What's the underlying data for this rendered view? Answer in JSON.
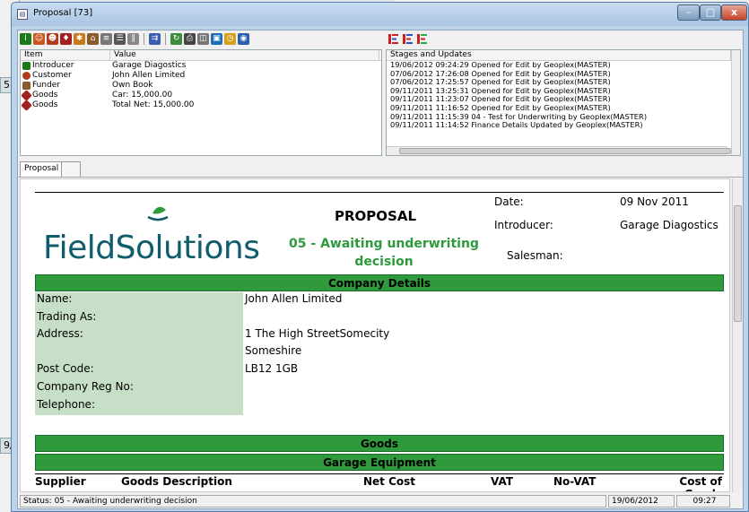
{
  "window": {
    "title": "Proposal [73]"
  },
  "background": {
    "left_chips": [
      "5]",
      "9/"
    ]
  },
  "panel": {
    "headers": [
      "Item",
      "Value"
    ],
    "rows": [
      {
        "item": "Introducer",
        "value": "Garage Diagostics",
        "icon": "introducer-icon",
        "color": "#1a7a1a"
      },
      {
        "item": "Customer",
        "value": "John Allen Limited",
        "icon": "customer-icon",
        "color": "#b33a1a"
      },
      {
        "item": "Funder",
        "value": "Own Book",
        "icon": "funder-icon",
        "color": "#8a5a2a"
      },
      {
        "item": "Goods",
        "value": "Car: 15,000.00",
        "icon": "goods-icon",
        "color": "#a52020"
      },
      {
        "item": "Goods",
        "value": "Total Net: 15,000.00",
        "icon": "goods-icon",
        "color": "#a52020"
      }
    ]
  },
  "stages": {
    "header": "Stages and Updates",
    "lines": [
      "19/06/2012 09:24:29 Opened for Edit by Geoplex(MASTER)",
      "07/06/2012 17:26:08 Opened for Edit by Geoplex(MASTER)",
      "07/06/2012 17:25:57 Opened for Edit by Geoplex(MASTER)",
      "09/11/2011 13:25:31 Opened for Edit by Geoplex(MASTER)",
      "09/11/2011 11:23:07 Opened for Edit by Geoplex(MASTER)",
      "09/11/2011 11:16:52 Opened for Edit by Geoplex(MASTER)",
      "09/11/2011 11:15:39 04 - Test for Underwriting by Geoplex(MASTER)",
      "09/11/2011 11:14:52 Finance Details Updated by Geoplex(MASTER)"
    ]
  },
  "tabs": {
    "proposal": "Proposal"
  },
  "document": {
    "logo": "FieldSolutions",
    "title": "PROPOSAL",
    "stage": "05 - Awaiting underwriting decision",
    "date_label": "Date:",
    "date_value": "09 Nov 2011",
    "introducer_label": "Introducer:",
    "introducer_value": "Garage Diagostics",
    "salesman_label": "Salesman:",
    "company_section": "Company Details",
    "details": [
      {
        "label": "Name:",
        "value": "John Allen Limited"
      },
      {
        "label": "Trading As:",
        "value": ""
      },
      {
        "label": "Address:",
        "value": "1 The High StreetSomecity"
      },
      {
        "label": "",
        "value": "Someshire"
      },
      {
        "label": "Post Code:",
        "value": "LB12 1GB"
      },
      {
        "label": "Company Reg No:",
        "value": ""
      },
      {
        "label": "Telephone:",
        "value": ""
      }
    ],
    "goods_section": "Goods",
    "goods_sub": "Garage Equipment",
    "goods_columns": [
      "Supplier",
      "Goods Description",
      "Net Cost",
      "VAT",
      "No-VAT",
      "Cost of Goods"
    ]
  },
  "status": {
    "text": "Status: 05 - Awaiting underwriting decision",
    "date": "19/06/2012",
    "time": "09:27"
  },
  "colors": {
    "accent_green": "#2e9a3c",
    "label_green": "#c6dfc6",
    "logo_teal": "#0f5c6b"
  }
}
